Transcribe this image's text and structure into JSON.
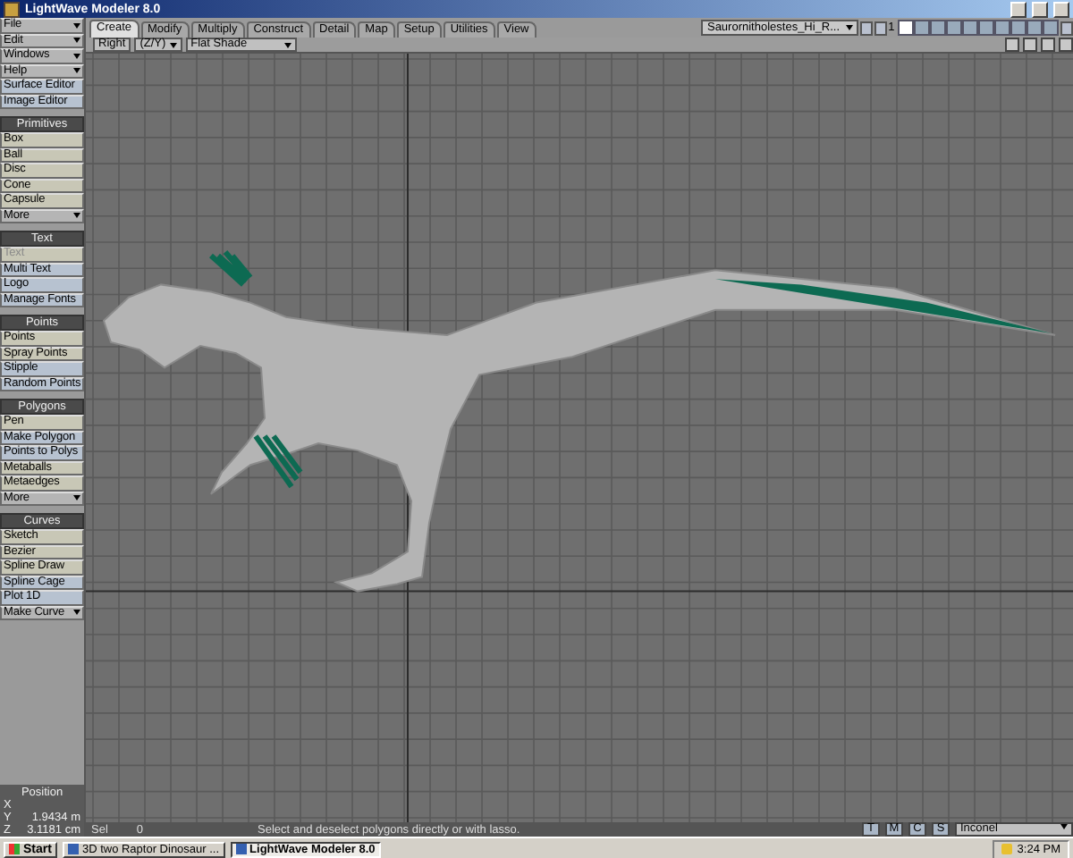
{
  "window": {
    "title": "LightWave Modeler 8.0"
  },
  "sidebar": {
    "groups": [
      {
        "items": [
          {
            "label": "File",
            "kind": "menu",
            "disabled": false
          },
          {
            "label": "Edit",
            "kind": "menu",
            "disabled": false
          },
          {
            "label": "Windows",
            "kind": "menu",
            "disabled": false
          },
          {
            "label": "Help",
            "kind": "menu",
            "disabled": false
          },
          {
            "label": "Surface Editor",
            "kind": "command",
            "disabled": false
          },
          {
            "label": "Image Editor",
            "kind": "command",
            "disabled": false
          }
        ]
      },
      {
        "title": "Primitives",
        "items": [
          {
            "label": "Box",
            "kind": "tool",
            "disabled": false
          },
          {
            "label": "Ball",
            "kind": "tool",
            "disabled": false
          },
          {
            "label": "Disc",
            "kind": "tool",
            "disabled": false
          },
          {
            "label": "Cone",
            "kind": "tool",
            "disabled": false
          },
          {
            "label": "Capsule",
            "kind": "tool",
            "disabled": false
          },
          {
            "label": "More",
            "kind": "menu",
            "disabled": false
          }
        ]
      },
      {
        "title": "Text",
        "items": [
          {
            "label": "Text",
            "kind": "tool",
            "disabled": true
          },
          {
            "label": "Multi Text",
            "kind": "command",
            "disabled": false
          },
          {
            "label": "Logo",
            "kind": "command",
            "disabled": false
          },
          {
            "label": "Manage Fonts",
            "kind": "command",
            "disabled": false
          }
        ]
      },
      {
        "title": "Points",
        "items": [
          {
            "label": "Points",
            "kind": "tool",
            "disabled": false
          },
          {
            "label": "Spray Points",
            "kind": "tool",
            "disabled": false
          },
          {
            "label": "Stipple",
            "kind": "command",
            "disabled": false
          },
          {
            "label": "Random Points",
            "kind": "command",
            "disabled": false
          }
        ]
      },
      {
        "title": "Polygons",
        "items": [
          {
            "label": "Pen",
            "kind": "tool",
            "disabled": false
          },
          {
            "label": "Make Polygon",
            "kind": "command",
            "disabled": false
          },
          {
            "label": "Points to Polys",
            "kind": "command",
            "disabled": false
          },
          {
            "label": "Metaballs",
            "kind": "tool",
            "disabled": false
          },
          {
            "label": "Metaedges",
            "kind": "tool",
            "disabled": false
          },
          {
            "label": "More",
            "kind": "menu",
            "disabled": false
          }
        ]
      },
      {
        "title": "Curves",
        "items": [
          {
            "label": "Sketch",
            "kind": "tool",
            "disabled": false
          },
          {
            "label": "Bezier",
            "kind": "tool",
            "disabled": false
          },
          {
            "label": "Spline Draw",
            "kind": "tool",
            "disabled": false
          },
          {
            "label": "Spline Cage",
            "kind": "command",
            "disabled": false
          },
          {
            "label": "Plot 1D",
            "kind": "command",
            "disabled": false
          },
          {
            "label": "Make Curve",
            "kind": "menu",
            "disabled": false
          }
        ]
      }
    ]
  },
  "position": {
    "title": "Position",
    "rows": [
      {
        "axis": "X"
      },
      {
        "axis": "Y",
        "value": "1.9434 m"
      },
      {
        "axis": "Z",
        "value": "3.1181 cm"
      }
    ]
  },
  "tabs": [
    {
      "label": "Create",
      "selected": true
    },
    {
      "label": "Modify",
      "selected": false
    },
    {
      "label": "Multiply",
      "selected": false
    },
    {
      "label": "Construct",
      "selected": false
    },
    {
      "label": "Detail",
      "selected": false
    },
    {
      "label": "Map",
      "selected": false
    },
    {
      "label": "Setup",
      "selected": false
    },
    {
      "label": "Utilities",
      "selected": false
    },
    {
      "label": "View",
      "selected": false
    }
  ],
  "object_dropdown": {
    "value": "Saurornitholestes_Hi_R..."
  },
  "layers": {
    "label": "1",
    "items": [
      {
        "selected": true
      },
      {
        "selected": false
      },
      {
        "selected": false
      },
      {
        "selected": false
      },
      {
        "selected": false
      },
      {
        "selected": false
      },
      {
        "selected": false
      },
      {
        "selected": false
      },
      {
        "selected": false
      },
      {
        "selected": false
      }
    ]
  },
  "viewport": {
    "view": "Right",
    "axes": "(Z/Y)",
    "shading": "Flat Shade"
  },
  "status_bar": {
    "sel_label": "Sel",
    "sel_count": "0",
    "message": "Select and deselect polygons directly or with lasso.",
    "modes": [
      "T",
      "M",
      "C",
      "S"
    ],
    "surface": "Inconel"
  },
  "taskbar": {
    "start": "Start",
    "tasks": [
      {
        "label": "3D two Raptor Dinosaur ...",
        "selected": false
      },
      {
        "label": "LightWave Modeler 8.0",
        "selected": true
      }
    ],
    "time": "3:24 PM"
  }
}
